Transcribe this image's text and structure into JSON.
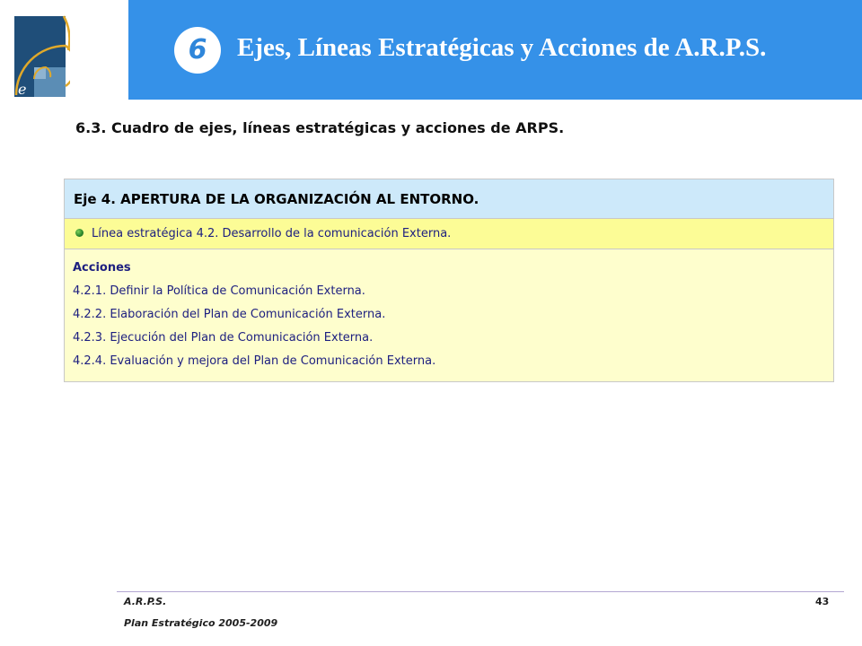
{
  "header": {
    "chapter_number": "6",
    "title": "Ejes, Líneas Estratégicas y Acciones de A.R.P.S.",
    "band_color": "#3591e8"
  },
  "logo": {
    "icon": "golden-spiral-logo-icon"
  },
  "section_heading": "6.3. Cuadro de ejes, líneas estratégicas y acciones de ARPS.",
  "table": {
    "eje": "Eje  4. APERTURA DE LA ORGANIZACIÓN AL ENTORNO.",
    "linea": "Línea estratégica 4.2. Desarrollo de la comunicación Externa.",
    "acciones_label": "Acciones",
    "acciones": [
      "4.2.1. Definir la Política de Comunicación Externa.",
      "4.2.2. Elaboración del Plan de Comunicación Externa.",
      "4.2.3. Ejecución del Plan de Comunicación Externa.",
      "4.2.4. Evaluación y mejora del Plan de Comunicación Externa."
    ],
    "colors": {
      "eje_bg": "#cde9fa",
      "linea_bg": "#fcfc96",
      "acciones_bg": "#fefecd"
    }
  },
  "footer": {
    "org": "A.R.P.S.",
    "plan": "Plan Estratégico 2005-2009",
    "page": "43"
  }
}
